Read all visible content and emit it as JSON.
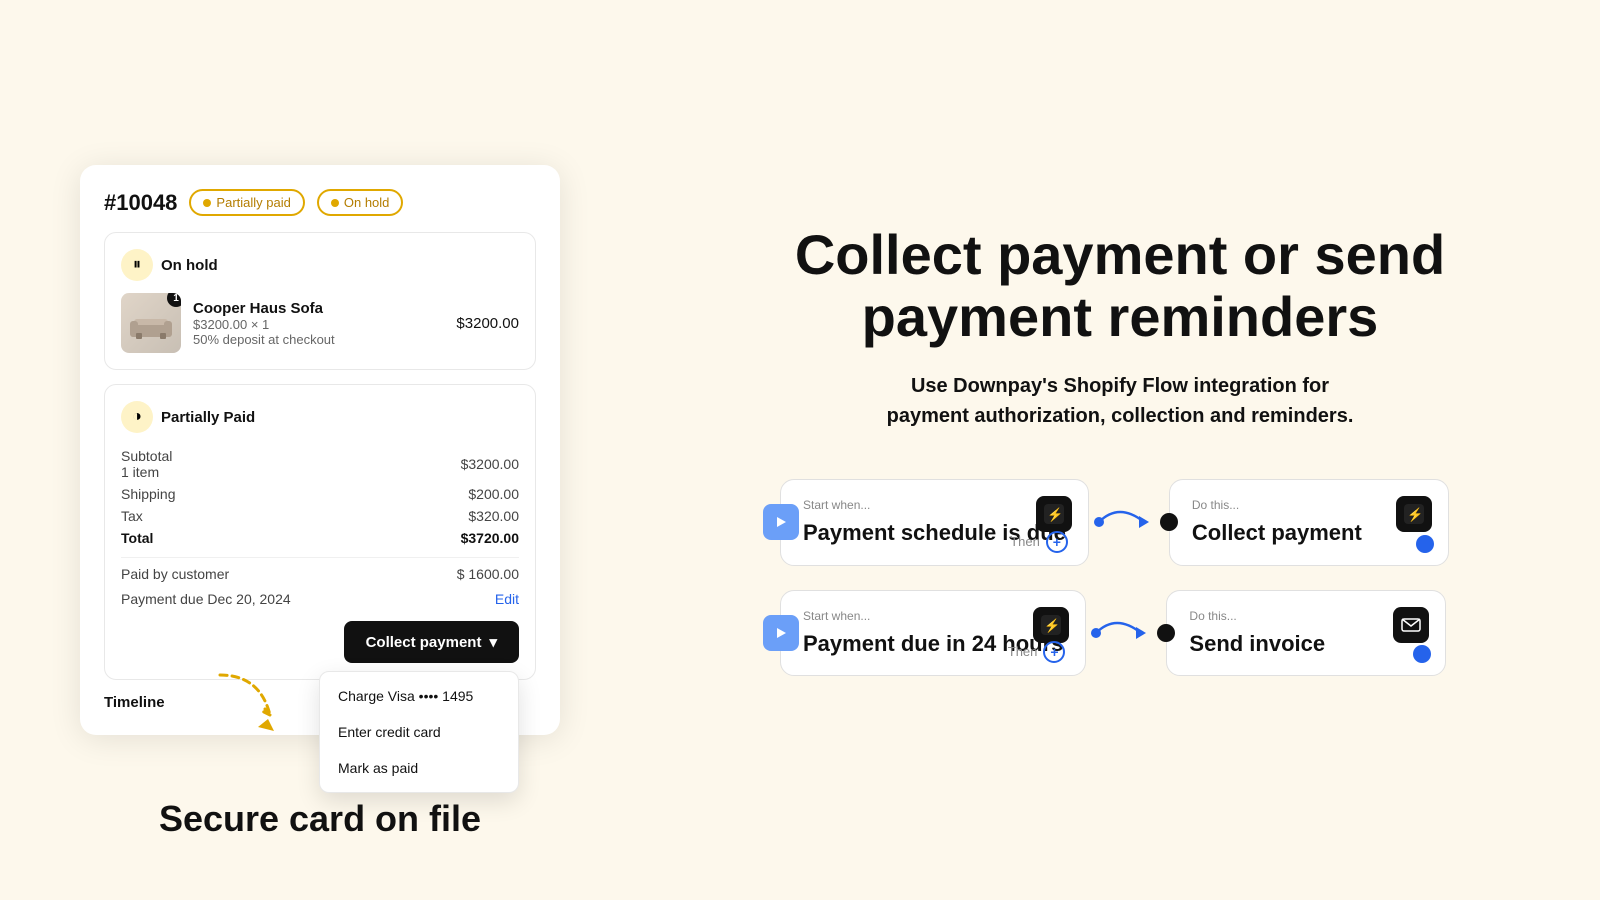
{
  "page": {
    "background": "#fdf8ec"
  },
  "left": {
    "order": {
      "number": "#10048",
      "badges": [
        {
          "label": "Partially paid",
          "type": "partially-paid"
        },
        {
          "label": "On hold",
          "type": "on-hold"
        }
      ],
      "on_hold_section": {
        "title": "On hold",
        "product": {
          "name": "Cooper Haus Sofa",
          "detail1": "$3200.00 × 1",
          "detail2": "50% deposit at checkout",
          "price": "$3200.00",
          "badge_num": "1"
        }
      },
      "partial_section": {
        "title": "Partially Paid",
        "subtotal_label": "Subtotal",
        "subtotal_items": "1 item",
        "subtotal_value": "$3200.00",
        "shipping_label": "Shipping",
        "shipping_value": "$200.00",
        "tax_label": "Tax",
        "tax_value": "$320.00",
        "total_label": "Total",
        "total_value": "$3720.00",
        "paid_label": "Paid by customer",
        "paid_value": "$ 1600.00",
        "due_label": "Payment due Dec 20, 2024",
        "edit_label": "Edit"
      },
      "collect_btn": "Collect payment",
      "dropdown": {
        "items": [
          "Charge Visa •••• 1495",
          "Enter credit card",
          "Mark as paid"
        ]
      },
      "timeline_label": "Timeline"
    },
    "bottom_title": "Secure card on file"
  },
  "right": {
    "hero_title": "Collect payment or send payment reminders",
    "hero_subtitle": "Use Downpay's Shopify Flow integration for payment authorization, collection and reminders.",
    "flows": [
      {
        "id": "flow1",
        "start_label": "Start when...",
        "start_title": "Payment schedule is due",
        "start_icon": "⚡",
        "then_label": "Then",
        "do_label": "Do this...",
        "do_title": "Collect payment",
        "do_icon": "⚡"
      },
      {
        "id": "flow2",
        "start_label": "Start when...",
        "start_title": "Payment due in 24 hours",
        "start_icon": "⚡",
        "then_label": "Then",
        "do_label": "Do this...",
        "do_title": "Send invoice",
        "do_icon": "✉"
      }
    ]
  }
}
